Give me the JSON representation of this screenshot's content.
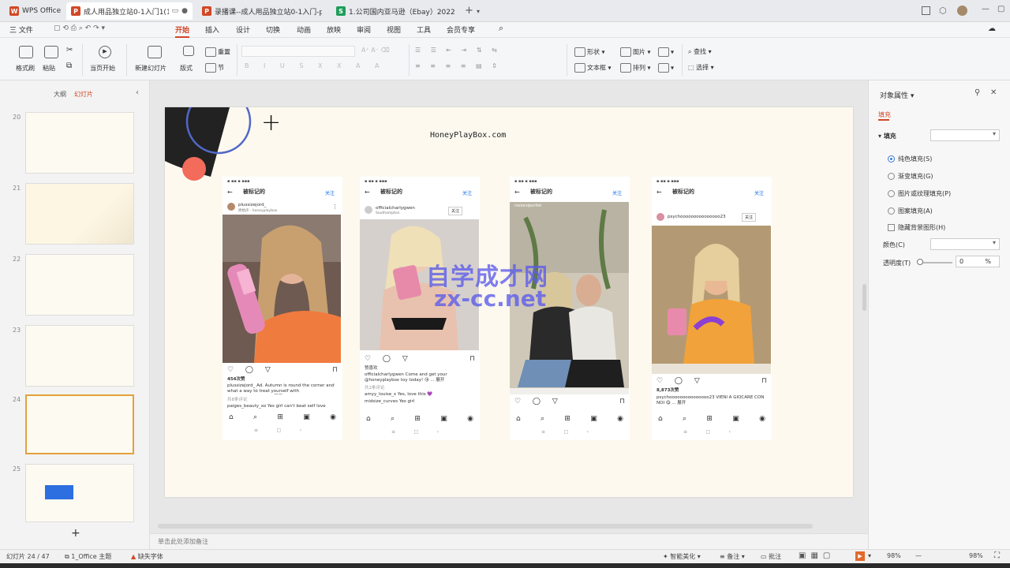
{
  "tabs": [
    {
      "label": "WPS Office",
      "icon": "wps-logo-icon",
      "color": "#d24726",
      "active": false
    },
    {
      "label": "成人用品独立站0-1入门1(1).p",
      "icon": "ppt-icon",
      "color": "#d24726",
      "active": true
    },
    {
      "label": "录播课--成人用品独立站0-1入门-p",
      "icon": "ppt-icon",
      "color": "#d24726",
      "active": false
    },
    {
      "label": "1.公司国内亚马逊（Ebay）2022.8.2",
      "icon": "sheet-icon",
      "color": "#1e9e5a",
      "active": false
    }
  ],
  "new_tab": "+",
  "menu": {
    "file": "三 文件",
    "items": [
      "开始",
      "插入",
      "设计",
      "切换",
      "动画",
      "放映",
      "审阅",
      "视图",
      "工具",
      "会员专享"
    ],
    "active": "开始"
  },
  "ribbon": {
    "format_painter": "格式刷",
    "paste": "粘贴",
    "start_from": "当页开始",
    "new_slide": "新建幻灯片",
    "layout": "版式",
    "reset": "重置",
    "section": "节",
    "shape": "形状",
    "picture": "图片",
    "textbox": "文本框",
    "arrange": "排列",
    "find": "查找",
    "select": "选择"
  },
  "left_panel": {
    "tab_outline": "大纲",
    "tab_slides": "幻灯片",
    "slide_numbers": [
      "20",
      "21",
      "22",
      "23",
      "24",
      "25"
    ],
    "add": "+"
  },
  "slide": {
    "site_title": "HoneyPlayBox.com",
    "plus_mark": "+",
    "phones": [
      {
        "header": "被标记的",
        "follow": "关注",
        "user": "plussizejord_",
        "sub": "原始声 · honeyplaybox",
        "likes": "454次赞",
        "caption": "plussizejord_ Ad. Autumn is round the corner and what a way to treat yourself with @honeyplaybox.co... 展开",
        "comments": "共8条评论",
        "reply": "paiges_beauty_xo Yes girl can't beat self love"
      },
      {
        "header": "被标记的",
        "follow": "关注",
        "user": "officialcharlygwen",
        "sub": "Southampton",
        "likes": "赞喜欢",
        "caption": "officialcharlygwen Come and get your @honeyplaybox toy today! 😘 ... 展开",
        "comments": "共2条评论",
        "reply": "amyy_louise_x Yes, love this 💜",
        "reply2": "midsize_curves Yes girl"
      },
      {
        "header": "被标记的",
        "follow": "关注",
        "user": "rosiorsiporitei",
        "sub": "honeyplaybox",
        "likes": "",
        "caption": "",
        "comments": "",
        "reply": ""
      },
      {
        "header": "被标记的",
        "follow": "关注",
        "user": "psychooooooooooooooo23",
        "sub": "",
        "likes": "8,873次赞",
        "caption": "psychooooooooooooooo23 VIENI A GIOCARE CON NOI 😋 ... 展开",
        "comments": "",
        "reply": ""
      }
    ]
  },
  "watermark": {
    "line1": "自学成才网",
    "line2": "zx-cc.net"
  },
  "right_panel": {
    "title": "对象属性",
    "tab_fill": "填充",
    "fill_label": "填充",
    "options": [
      "纯色填充(S)",
      "渐变填充(G)",
      "图片或纹理填充(P)",
      "图案填充(A)"
    ],
    "selected": "纯色填充(S)",
    "hide_bg": "隐藏背景图形(H)",
    "color_label": "颜色(C)",
    "transparency_label": "透明度(T)",
    "transparency_value": "0",
    "percent": "%"
  },
  "notes_placeholder": "单击此处添加备注",
  "status": {
    "slide_count": "幻灯片 24 / 47",
    "theme": "1_Office 主题",
    "missing_font": "缺失字体",
    "beautify": "智能美化",
    "notes": "备注",
    "comments": "批注",
    "zoom1": "98%",
    "zoom2": "98%"
  }
}
